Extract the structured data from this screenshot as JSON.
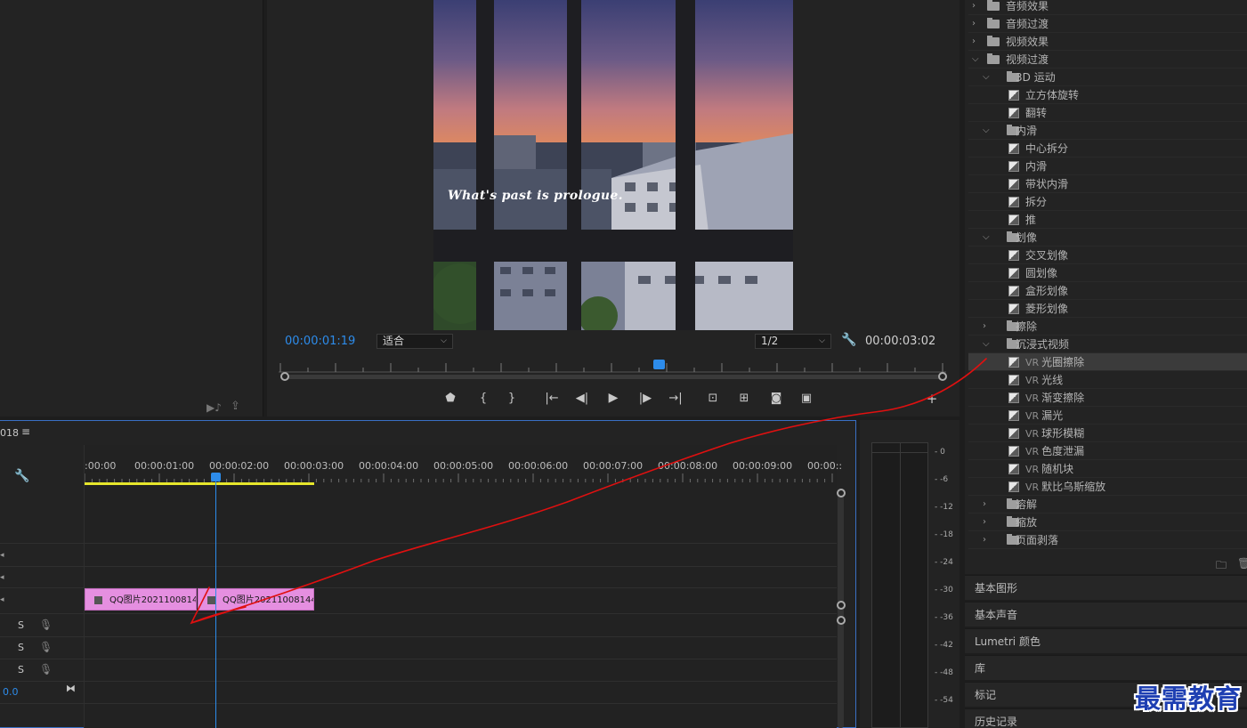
{
  "program": {
    "timecode_current": "00:00:01:19",
    "timecode_duration": "00:00:03:02",
    "zoom_select": "适合",
    "resolution_select": "1/2",
    "caption": "What's past is prologue."
  },
  "timeline": {
    "sequence_fragment": "018",
    "ruler_labels": [
      ":00:00",
      "00:00:01:00",
      "00:00:02:00",
      "00:00:03:00",
      "00:00:04:00",
      "00:00:05:00",
      "00:00:06:00",
      "00:00:07:00",
      "00:00:08:00",
      "00:00:09:00",
      "00:00::"
    ],
    "clips": [
      {
        "label": "QQ图片20211008144"
      },
      {
        "label": "QQ图片202110081443"
      }
    ],
    "audio_track_solo": [
      "S",
      "S",
      "S"
    ],
    "master_level": "0.0"
  },
  "meter": {
    "scale": [
      "0",
      "-6",
      "-12",
      "-18",
      "-24",
      "-30",
      "-36",
      "-42",
      "-48",
      "-54"
    ]
  },
  "effects_tree": [
    {
      "level": 0,
      "type": "folder",
      "open": false,
      "label": "音频效果"
    },
    {
      "level": 0,
      "type": "folder",
      "open": false,
      "label": "音频过渡"
    },
    {
      "level": 0,
      "type": "folder",
      "open": false,
      "label": "视频效果"
    },
    {
      "level": 0,
      "type": "folder",
      "open": true,
      "label": "视频过渡"
    },
    {
      "level": 1,
      "type": "folder",
      "open": true,
      "label": "3D 运动"
    },
    {
      "level": 2,
      "type": "fx",
      "label": "立方体旋转"
    },
    {
      "level": 2,
      "type": "fx",
      "label": "翻转"
    },
    {
      "level": 1,
      "type": "folder",
      "open": true,
      "label": "内滑"
    },
    {
      "level": 2,
      "type": "fx",
      "label": "中心拆分"
    },
    {
      "level": 2,
      "type": "fx",
      "label": "内滑"
    },
    {
      "level": 2,
      "type": "fx",
      "label": "带状内滑"
    },
    {
      "level": 2,
      "type": "fx",
      "label": "拆分"
    },
    {
      "level": 2,
      "type": "fx",
      "label": "推"
    },
    {
      "level": 1,
      "type": "folder",
      "open": true,
      "label": "划像"
    },
    {
      "level": 2,
      "type": "fx",
      "label": "交叉划像"
    },
    {
      "level": 2,
      "type": "fx",
      "label": "圆划像"
    },
    {
      "level": 2,
      "type": "fx",
      "label": "盒形划像"
    },
    {
      "level": 2,
      "type": "fx",
      "label": "菱形划像"
    },
    {
      "level": 1,
      "type": "folder",
      "open": false,
      "label": "擦除"
    },
    {
      "level": 1,
      "type": "folder",
      "open": true,
      "label": "沉浸式视频"
    },
    {
      "level": 2,
      "type": "fx",
      "vr": "VR",
      "label": "光圈擦除",
      "selected": true
    },
    {
      "level": 2,
      "type": "fx",
      "vr": "VR",
      "label": "光线"
    },
    {
      "level": 2,
      "type": "fx",
      "vr": "VR",
      "label": "渐变擦除"
    },
    {
      "level": 2,
      "type": "fx",
      "vr": "VR",
      "label": "漏光"
    },
    {
      "level": 2,
      "type": "fx",
      "vr": "VR",
      "label": "球形模糊"
    },
    {
      "level": 2,
      "type": "fx",
      "vr": "VR",
      "label": "色度泄漏"
    },
    {
      "level": 2,
      "type": "fx",
      "vr": "VR",
      "label": "随机块"
    },
    {
      "level": 2,
      "type": "fx",
      "vr": "VR",
      "label": "默比乌斯缩放"
    },
    {
      "level": 1,
      "type": "folder",
      "open": false,
      "label": "溶解"
    },
    {
      "level": 1,
      "type": "folder",
      "open": false,
      "label": "缩放"
    },
    {
      "level": 1,
      "type": "folder",
      "open": false,
      "label": "页面剥落"
    }
  ],
  "side_panels": [
    "基本图形",
    "基本声音",
    "Lumetri 颜色",
    "库",
    "标记",
    "历史记录"
  ],
  "watermark": "最需教育",
  "colors": {
    "accent_blue": "#2d8ceb",
    "clip_pink": "#e58fe0",
    "work_area_yellow": "#e6e62c",
    "annotation_red": "#e01010"
  }
}
